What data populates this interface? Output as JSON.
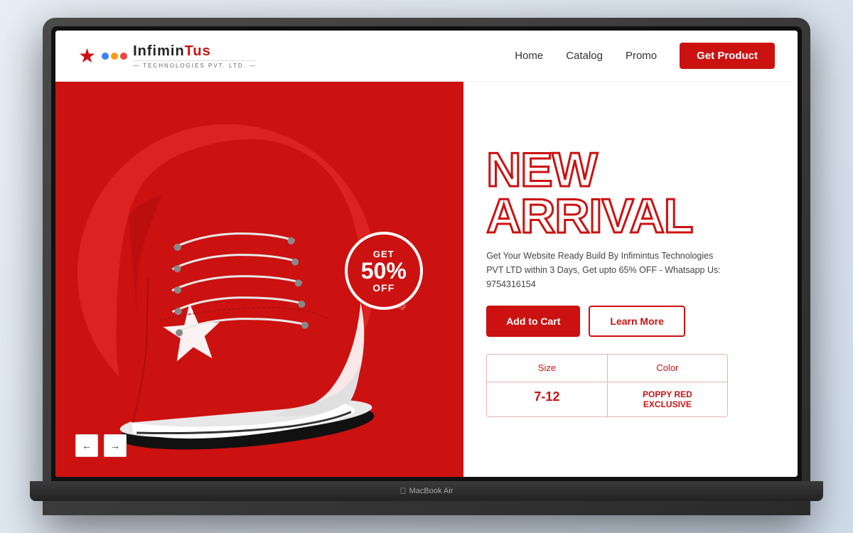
{
  "body_bg": "#d8e4f0",
  "side_watermark": {
    "line1": "INFIMINTUS",
    "line2": "— TECHNOLOGIES PVT. LTD. —"
  },
  "laptop": {
    "brand": "MacBook Air"
  },
  "navbar": {
    "logo_name": "InfiminTus",
    "logo_sub": "— TECHNOLOGIES PVT. LTD. —",
    "nav_home": "Home",
    "nav_catalog": "Catalog",
    "nav_promo": "Promo",
    "nav_cta": "Get Product"
  },
  "hero": {
    "discount_get": "GET",
    "discount_percent": "50%",
    "discount_off": "OFF",
    "title_line1": "NEW",
    "title_line2": "ARRIVAL",
    "description": "Get Your Website Ready Build By Infimintus Technologies PVT LTD within 3 Days, Get upto 65% OFF - Whatsapp Us: 9754316154",
    "btn_cart": "Add to Cart",
    "btn_learn": "Learn More",
    "size_label": "Size",
    "color_label": "Color",
    "size_value": "7-12",
    "color_value": "POPPY RED EXCLUSIVE",
    "arrow_left": "←",
    "arrow_right": "→",
    "bg_label": "backgr"
  }
}
